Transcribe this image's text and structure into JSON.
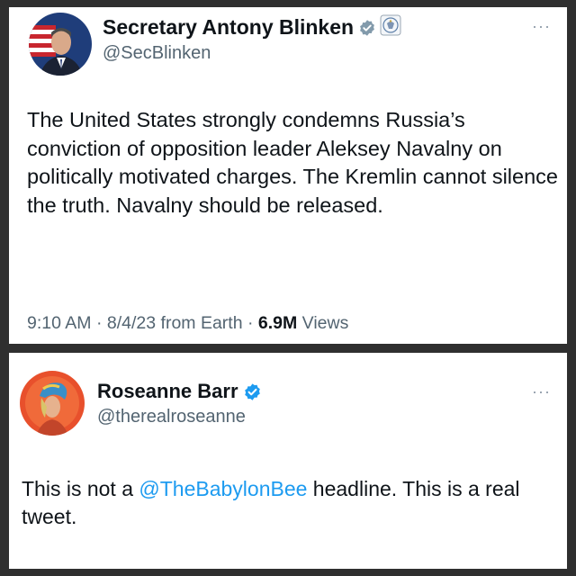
{
  "tweets": [
    {
      "name": "Secretary Antony Blinken",
      "handle": "@SecBlinken",
      "more_label": "···",
      "badge_color": "#829aab",
      "text": "The United States strongly condemns Russia’s conviction of opposition leader Aleksey Navalny on politically motivated charges. The Kremlin cannot silence the truth. Navalny should be released.",
      "meta": {
        "time": "9:10 AM",
        "sep1": " · ",
        "date": "8/4/23",
        "source": " from Earth",
        "sep2": " · ",
        "views_count": "6.9M",
        "views_label": " Views"
      }
    },
    {
      "name": "Roseanne Barr",
      "handle": "@therealroseanne",
      "more_label": "···",
      "badge_color": "#1d9bf0",
      "text_before": "This is not a ",
      "mention": "@TheBabylonBee",
      "text_after": " headline. This is a real tweet."
    }
  ],
  "colors": {
    "text": "#0f1419",
    "secondary": "#536471",
    "link": "#1d9bf0",
    "background": "#2f2f2f"
  }
}
